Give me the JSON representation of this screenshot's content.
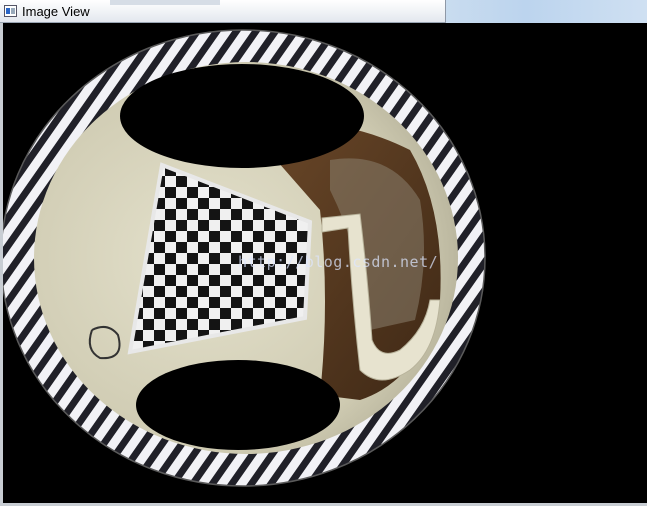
{
  "window": {
    "title": "Image View",
    "icon": "image-view-app-icon"
  },
  "image": {
    "description_id": "undistorted-fisheye-image",
    "watermark": "http://blog.csdn.net/"
  },
  "colors": {
    "background": "#000000",
    "frame": "#c8cdd3",
    "titlebar": "#eef1f5",
    "room_wall": "#d8d4bd",
    "checker_dark": "#1a1a1a",
    "checker_light": "#f2f2f2",
    "door_wood": "#5a3b22"
  }
}
